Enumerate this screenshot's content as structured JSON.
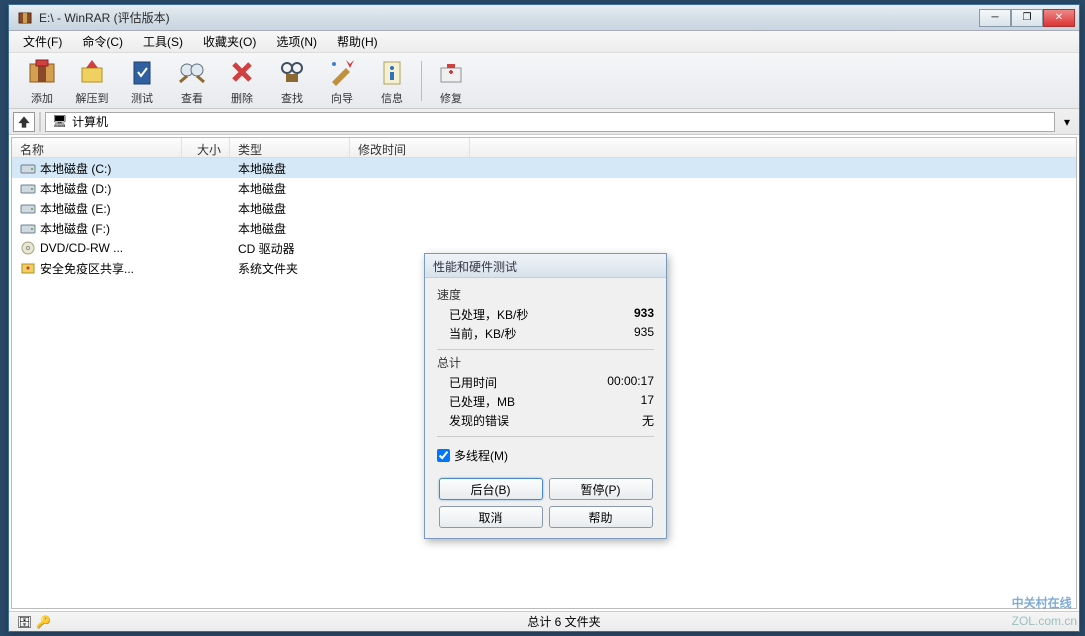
{
  "window": {
    "title": "E:\\ - WinRAR (评估版本)"
  },
  "menu": {
    "file": "文件(F)",
    "commands": "命令(C)",
    "tools": "工具(S)",
    "favorites": "收藏夹(O)",
    "options": "选项(N)",
    "help": "帮助(H)"
  },
  "toolbar": {
    "add": "添加",
    "extract": "解压到",
    "test": "测试",
    "view": "查看",
    "delete": "删除",
    "find": "查找",
    "wizard": "向导",
    "info": "信息",
    "repair": "修复"
  },
  "address": {
    "location": "计算机"
  },
  "columns": {
    "name": "名称",
    "size": "大小",
    "type": "类型",
    "modified": "修改时间"
  },
  "files": [
    {
      "icon": "drive",
      "name": "本地磁盘 (C:)",
      "type": "本地磁盘"
    },
    {
      "icon": "drive",
      "name": "本地磁盘 (D:)",
      "type": "本地磁盘"
    },
    {
      "icon": "drive",
      "name": "本地磁盘 (E:)",
      "type": "本地磁盘"
    },
    {
      "icon": "drive",
      "name": "本地磁盘 (F:)",
      "type": "本地磁盘"
    },
    {
      "icon": "cd",
      "name": "DVD/CD-RW ...",
      "type": "CD 驱动器"
    },
    {
      "icon": "sys",
      "name": "安全免疫区共享...",
      "type": "系统文件夹"
    }
  ],
  "statusbar": {
    "text": "总计 6 文件夹"
  },
  "dialog": {
    "title": "性能和硬件测试",
    "speed_header": "速度",
    "processed_kb_label": "已处理，KB/秒",
    "processed_kb_value": "933",
    "current_kb_label": "当前，KB/秒",
    "current_kb_value": "935",
    "total_header": "总计",
    "elapsed_label": "已用时间",
    "elapsed_value": "00:00:17",
    "processed_mb_label": "已处理，MB",
    "processed_mb_value": "17",
    "errors_label": "发现的错误",
    "errors_value": "无",
    "multithread_label": "多线程(M)",
    "multithread_checked": true,
    "btn_background": "后台(B)",
    "btn_pause": "暂停(P)",
    "btn_cancel": "取消",
    "btn_help": "帮助"
  },
  "watermark": {
    "brand": "中关村在线",
    "url": "ZOL.com.cn"
  }
}
